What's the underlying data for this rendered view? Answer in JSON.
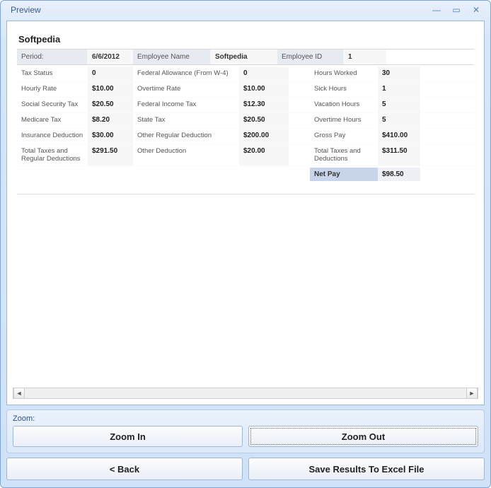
{
  "window": {
    "title": "Preview"
  },
  "doc": {
    "company": "Softpedia",
    "header": {
      "period_label": "Period:",
      "period_value": "6/6/2012",
      "empname_label": "Employee Name",
      "empname_value": "Softpedia",
      "empid_label": "Employee ID",
      "empid_value": "1"
    },
    "rows": [
      {
        "l1": "Tax Status",
        "v1": "0",
        "l2": "Federal Allowance (From W-4)",
        "v2": "0",
        "l3": "Hours Worked",
        "v3": "30"
      },
      {
        "l1": "Hourly Rate",
        "v1": "$10.00",
        "l2": "Overtime Rate",
        "v2": "$10.00",
        "l3": "Sick Hours",
        "v3": "1"
      },
      {
        "l1": "Social Security Tax",
        "v1": "$20.50",
        "l2": "Federal Income Tax",
        "v2": "$12.30",
        "l3": "Vacation Hours",
        "v3": "5"
      },
      {
        "l1": "Medicare Tax",
        "v1": "$8.20",
        "l2": "State Tax",
        "v2": "$20.50",
        "l3": "Overtime Hours",
        "v3": "5"
      },
      {
        "l1": "Insurance Deduction",
        "v1": "$30.00",
        "l2": "Other Regular Deduction",
        "v2": "$200.00",
        "l3": "Gross Pay",
        "v3": "$410.00"
      },
      {
        "l1": "Total Taxes and Regular Deductions",
        "v1": "$291.50",
        "l2": "Other Deduction",
        "v2": "$20.00",
        "l3": "Total Taxes and Deductions",
        "v3": "$311.50"
      }
    ],
    "net": {
      "label": "Net Pay",
      "value": "$98.50"
    }
  },
  "zoom": {
    "legend": "Zoom:",
    "in_label": "Zoom In",
    "out_label": "Zoom Out"
  },
  "footer": {
    "back_label": "< Back",
    "save_label": "Save Results To Excel File"
  }
}
